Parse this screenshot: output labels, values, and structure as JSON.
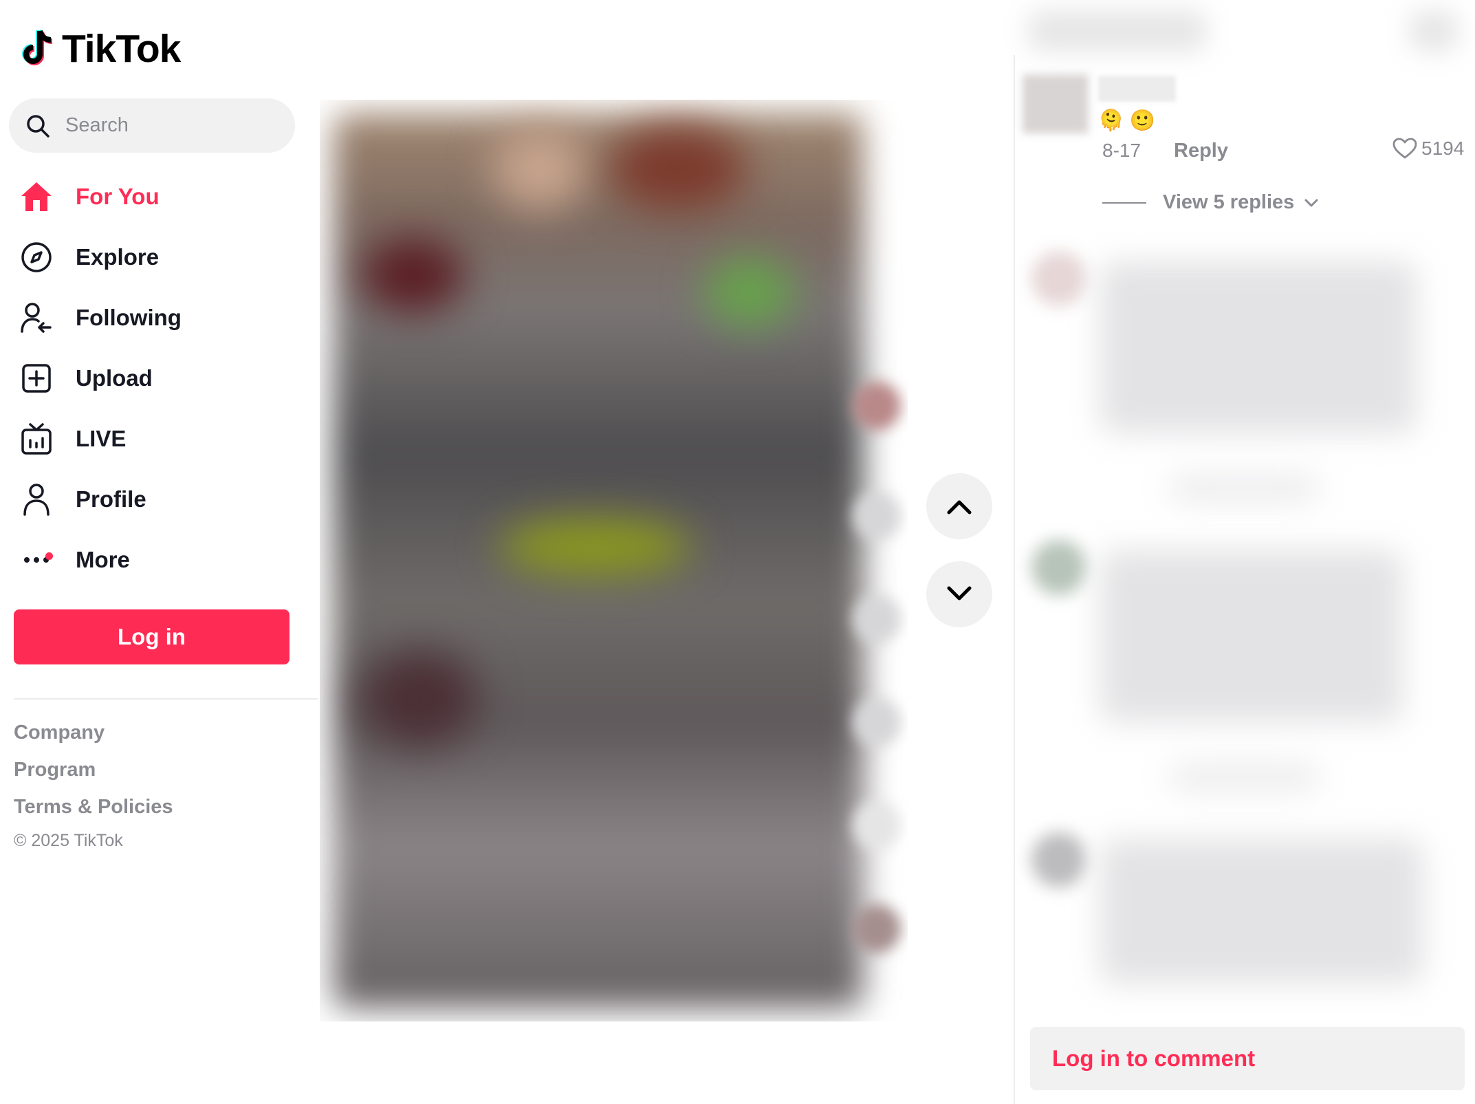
{
  "brand": {
    "name": "TikTok"
  },
  "search": {
    "placeholder": "Search"
  },
  "nav": {
    "items": [
      {
        "label": "For You",
        "icon": "home-icon",
        "active": true
      },
      {
        "label": "Explore",
        "icon": "compass-icon",
        "active": false
      },
      {
        "label": "Following",
        "icon": "following-icon",
        "active": false
      },
      {
        "label": "Upload",
        "icon": "upload-icon",
        "active": false
      },
      {
        "label": "LIVE",
        "icon": "live-tv-icon",
        "active": false
      },
      {
        "label": "Profile",
        "icon": "profile-icon",
        "active": false
      },
      {
        "label": "More",
        "icon": "more-dots-icon",
        "active": false
      }
    ]
  },
  "login_button": {
    "label": "Log in"
  },
  "footer": {
    "links": [
      "Company",
      "Program",
      "Terms & Policies"
    ],
    "copyright": "© 2025 TikTok"
  },
  "comment": {
    "emoji": "🫠 🙂",
    "date": "8-17",
    "reply_label": "Reply",
    "like_count": "5194",
    "view_replies_label": "View 5 replies"
  },
  "comment_login": {
    "label": "Log in to comment"
  },
  "colors": {
    "accent": "#fe2c55",
    "muted_text": "#8a8b91",
    "surface": "#f1f1f2"
  }
}
